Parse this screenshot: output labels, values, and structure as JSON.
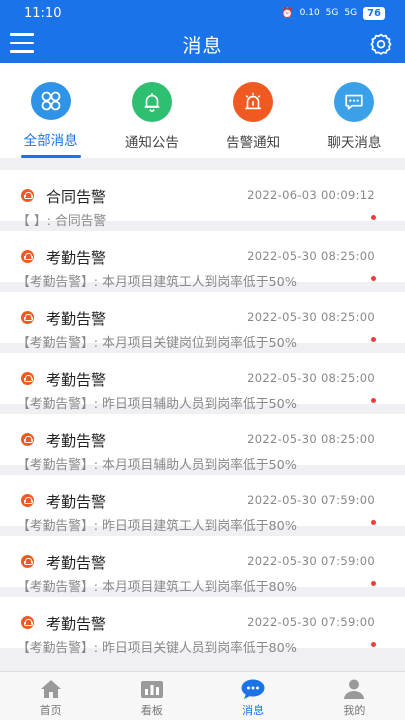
{
  "status": {
    "time": "11:10",
    "battery": "76",
    "net1": "0.10",
    "net2": "5G",
    "net3": "5G"
  },
  "header": {
    "title": "消息"
  },
  "tabs": [
    {
      "label": "全部消息",
      "icon": "grid-icon",
      "color": "#2f93e8"
    },
    {
      "label": "通知公告",
      "icon": "bell-icon",
      "color": "#2fbf71"
    },
    {
      "label": "告警通知",
      "icon": "alarm-icon",
      "color": "#f05a22"
    },
    {
      "label": "聊天消息",
      "icon": "chat-icon",
      "color": "#3aa0e8"
    }
  ],
  "messages": [
    {
      "title": "合同告警",
      "time": "2022-06-03  00:09:12",
      "content": "【 】: 合同告警"
    },
    {
      "title": "考勤告警",
      "time": "2022-05-30  08:25:00",
      "content": "【考勤告警】: 本月项目建筑工人到岗率低于50%"
    },
    {
      "title": "考勤告警",
      "time": "2022-05-30  08:25:00",
      "content": "【考勤告警】: 本月项目关键岗位到岗率低于50%"
    },
    {
      "title": "考勤告警",
      "time": "2022-05-30  08:25:00",
      "content": "【考勤告警】: 昨日项目辅助人员到岗率低于50%"
    },
    {
      "title": "考勤告警",
      "time": "2022-05-30  08:25:00",
      "content": "【考勤告警】: 本月项目辅助人员到岗率低于50%"
    },
    {
      "title": "考勤告警",
      "time": "2022-05-30  07:59:00",
      "content": "【考勤告警】: 昨日项目建筑工人到岗率低于80%"
    },
    {
      "title": "考勤告警",
      "time": "2022-05-30  07:59:00",
      "content": "【考勤告警】: 本月项目建筑工人到岗率低于80%"
    },
    {
      "title": "考勤告警",
      "time": "2022-05-30  07:59:00",
      "content": "【考勤告警】: 昨日项目关键人员到岗率低于80%"
    }
  ],
  "tabbar": [
    {
      "label": "首页",
      "icon": "home-icon"
    },
    {
      "label": "看板",
      "icon": "dashboard-icon"
    },
    {
      "label": "消息",
      "icon": "message-icon"
    },
    {
      "label": "我的",
      "icon": "profile-icon"
    }
  ],
  "colors": {
    "primary": "#1a73e8",
    "alert": "#f05a22",
    "unread": "#f23c3c"
  }
}
